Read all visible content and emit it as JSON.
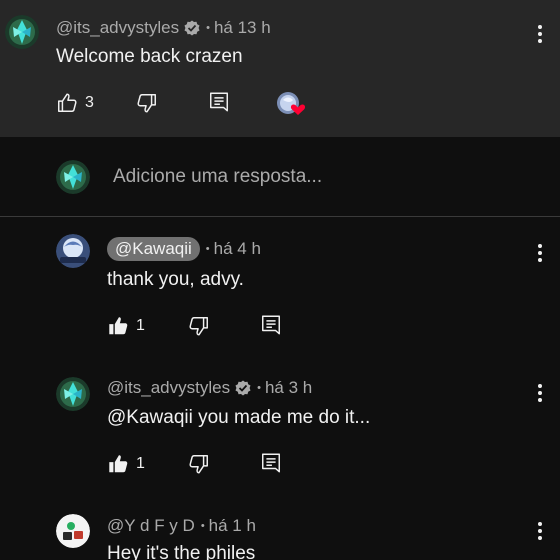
{
  "parent": {
    "author": "@its_advystyles",
    "time": "há 13 h",
    "text": "Welcome back crazen",
    "likes": "3"
  },
  "reply_box": {
    "placeholder": "Adicione uma resposta..."
  },
  "replies": [
    {
      "author": "@Kawaqii",
      "time": "há 4 h",
      "text": "thank you, advy.",
      "likes": "1"
    },
    {
      "author": "@its_advystyles",
      "time": "há 3 h",
      "text": "@Kawaqii  you made me do it...",
      "likes": "1"
    },
    {
      "author": "@Y d F y D",
      "time": "há 1 h",
      "text": "Hey it's the philes"
    }
  ],
  "colors": {
    "background": "#0f0f0f",
    "highlight": "#272727",
    "secondary_text": "#aaaaaa",
    "heart": "#ff0033"
  }
}
